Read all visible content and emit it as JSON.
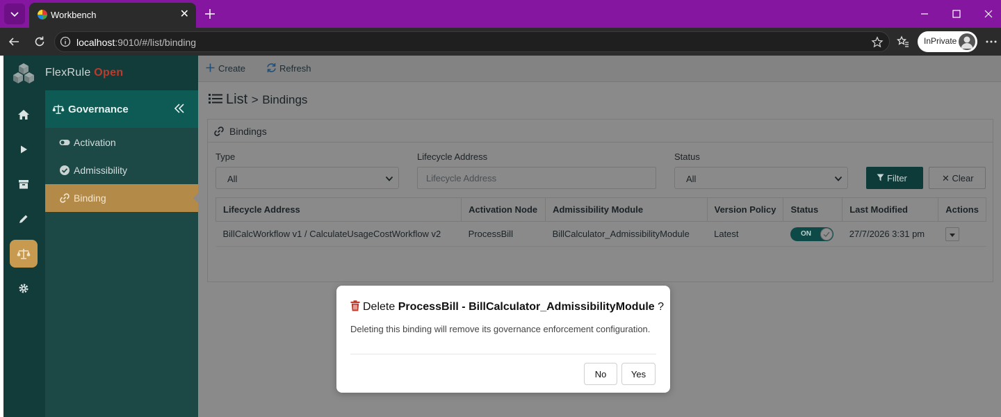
{
  "browser": {
    "tab_title": "Workbench",
    "tab_close": "✕",
    "address_host": "localhost",
    "address_path": ":9010/#/list/binding",
    "inprivate_label": "InPrivate"
  },
  "app": {
    "brand_name": "FlexRule",
    "brand_accent": "Open",
    "colors": {
      "accent": "#0e5a55",
      "active": "#b38a47",
      "brand_accent": "#c0392b",
      "delete": "#c0392b"
    }
  },
  "sidebar": {
    "section_title": "Governance",
    "items": [
      {
        "label": "Activation",
        "icon": "toggle-icon"
      },
      {
        "label": "Admissibility",
        "icon": "check-circle-icon"
      },
      {
        "label": "Binding",
        "icon": "link-icon"
      }
    ],
    "active_index": 2
  },
  "toolbar": {
    "create_label": "Create",
    "refresh_label": "Refresh"
  },
  "page": {
    "title": "List",
    "separator": ">",
    "crumb": "Bindings"
  },
  "panel": {
    "title": "Bindings",
    "filters": {
      "type_label": "Type",
      "type_value": "All",
      "lifecycle_label": "Lifecycle Address",
      "lifecycle_placeholder": "Lifecycle Address",
      "status_label": "Status",
      "status_value": "All",
      "filter_label": "Filter",
      "clear_label": "✕ Clear"
    },
    "table": {
      "headers": [
        "Lifecycle Address",
        "Activation Node",
        "Admissibility Module",
        "Version Policy",
        "Status",
        "Last Modified",
        "Actions"
      ],
      "rows": [
        {
          "lifecycle": "BillCalcWorkflow v1 / CalculateUsageCostWorkflow v2",
          "node": "ProcessBill",
          "module": "BillCalculator_AdmissibilityModule",
          "policy": "Latest",
          "status": "ON",
          "modified": "27/7/2026 3:31 pm"
        }
      ]
    }
  },
  "modal": {
    "prefix": "Delete",
    "target": "ProcessBill - BillCalculator_AdmissibilityModule",
    "suffix": "?",
    "body": "Deleting this binding will remove its governance enforcement configuration.",
    "no_label": "No",
    "yes_label": "Yes"
  }
}
